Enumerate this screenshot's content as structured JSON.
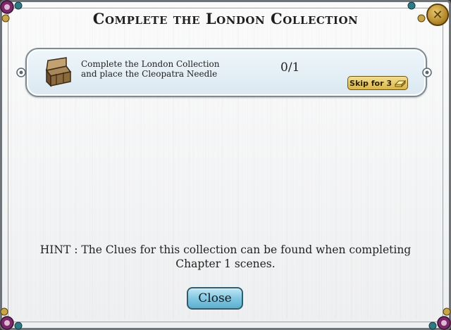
{
  "dialog": {
    "title": "Complete the London Collection",
    "close_x_label": "✕"
  },
  "quest": {
    "icon": "treasure-chest-icon",
    "line1": "Complete the London Collection",
    "line2": "and place the Cleopatra Needle",
    "progress": "0/1",
    "skip_label": "Skip for 3",
    "skip_currency_icon": "gold-bar-icon"
  },
  "hint": {
    "line1": "HINT : The Clues for this collection can be found when completing",
    "line2": "Chapter 1 scenes."
  },
  "footer": {
    "close_label": "Close"
  },
  "colors": {
    "panel_bg": "#dbe8f0",
    "skip_gold": "#d9b54b",
    "close_blue": "#7cc6e0",
    "ornament_purple": "#7a2a6a",
    "ornament_teal": "#2e7a86"
  }
}
